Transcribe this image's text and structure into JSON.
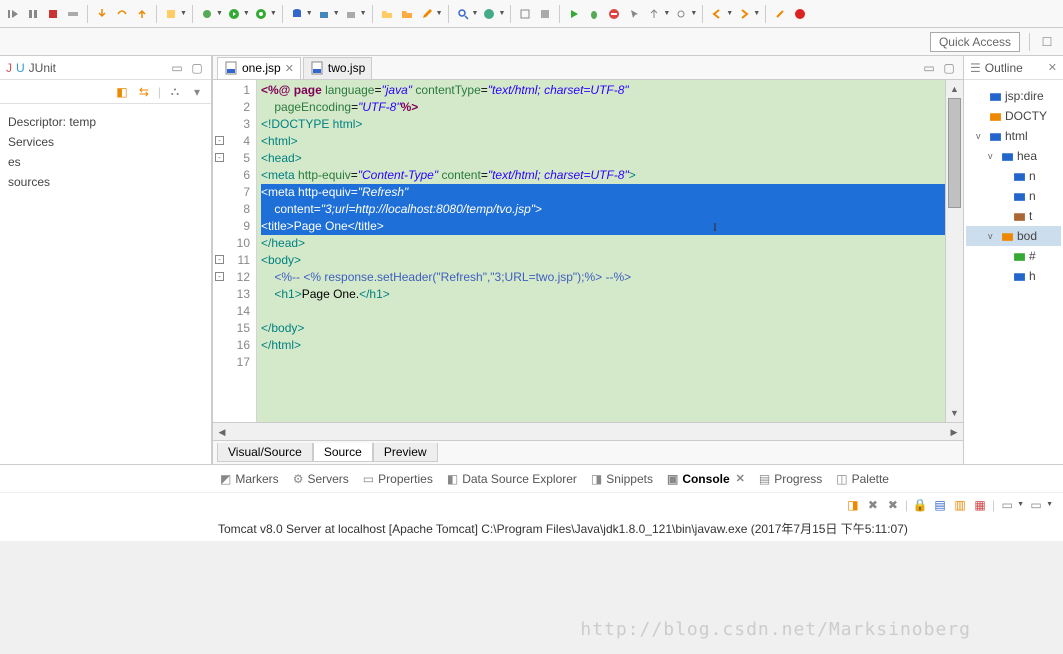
{
  "quick_access": "Quick Access",
  "left_panel": {
    "title": "JUnit",
    "tree": [
      "Descriptor: temp",
      " Services",
      "es",
      "sources"
    ]
  },
  "tabs": {
    "active": "one.jsp",
    "inactive": "two.jsp"
  },
  "code": {
    "lines": [
      {
        "n": 1,
        "html": "<span class='maroon'>&lt;%@</span> <span class='maroon'>page</span> <span class='green-t'>language</span>=<span class='blue-s'>\"java\"</span> <span class='green-t'>contentType</span>=<span class='blue-s'>\"text/html; charset=UTF-8\"</span>"
      },
      {
        "n": 2,
        "html": "    <span class='green-t'>pageEncoding</span>=<span class='blue-s'>\"UTF-8\"</span><span class='maroon'>%&gt;</span>"
      },
      {
        "n": 3,
        "html": "<span class='teal'>&lt;!DOCTYPE html&gt;</span>"
      },
      {
        "n": 4,
        "fold": "-",
        "html": "<span class='teal'>&lt;html&gt;</span>"
      },
      {
        "n": 5,
        "fold": "-",
        "html": "<span class='teal'>&lt;head&gt;</span>"
      },
      {
        "n": 6,
        "html": "<span class='teal'>&lt;meta</span> <span class='green-t'>http-equiv</span>=<span class='blue-s'>\"Content-Type\"</span> <span class='green-t'>content</span>=<span class='blue-s'>\"text/html; charset=UTF-8\"</span><span class='teal'>&gt;</span>"
      },
      {
        "n": 7,
        "sel": true,
        "html": "&lt;meta http-equiv=<span class='green-i'>\"Refresh\"</span>"
      },
      {
        "n": 8,
        "sel": true,
        "html": "    content=<span class='green-i'>\"3;url=http://localhost:8080/temp/tvo.jsp\"</span>&gt;"
      },
      {
        "n": 9,
        "sel": true,
        "html": "&lt;title&gt;Page One&lt;/title&gt;"
      },
      {
        "n": 10,
        "html": "<span class='teal'>&lt;/head&gt;</span>"
      },
      {
        "n": 11,
        "fold": "-",
        "html": "<span class='teal'>&lt;body&gt;</span>"
      },
      {
        "n": 12,
        "fold": "-",
        "html": "    <span class='cm'>&lt;%-- &lt;% response.setHeader(\"Refresh\",\"3;URL=two.jsp\");%&gt; --%&gt;</span>"
      },
      {
        "n": 13,
        "html": "    <span class='teal'>&lt;h1&gt;</span><span class='black'>Page One.</span><span class='teal'>&lt;/h1&gt;</span>"
      },
      {
        "n": 14,
        "html": ""
      },
      {
        "n": 15,
        "html": "<span class='teal'>&lt;/body&gt;</span>"
      },
      {
        "n": 16,
        "html": "<span class='teal'>&lt;/html&gt;</span>"
      },
      {
        "n": 17,
        "html": ""
      }
    ]
  },
  "bottom_tabs": [
    "Visual/Source",
    "Source",
    "Preview"
  ],
  "views": [
    "Markers",
    "Servers",
    "Properties",
    "Data Source Explorer",
    "Snippets",
    "Console",
    "Progress",
    "Palette"
  ],
  "active_view": "Console",
  "console_line": "Tomcat v8.0 Server at localhost [Apache Tomcat] C:\\Program Files\\Java\\jdk1.8.0_121\\bin\\javaw.exe (2017年7月15日 下午5:11:07)",
  "outline": {
    "title": "Outline",
    "items": [
      {
        "indent": 1,
        "icon": "blue",
        "label": "jsp:dire"
      },
      {
        "indent": 1,
        "icon": "orange",
        "label": "DOCTY"
      },
      {
        "indent": 1,
        "twist": "v",
        "icon": "blue",
        "label": "html"
      },
      {
        "indent": 2,
        "twist": "v",
        "icon": "blue",
        "label": "hea"
      },
      {
        "indent": 3,
        "icon": "blue",
        "label": "n"
      },
      {
        "indent": 3,
        "icon": "blue",
        "label": "n"
      },
      {
        "indent": 3,
        "icon": "brown",
        "label": "t"
      },
      {
        "indent": 2,
        "twist": "v",
        "icon": "orange",
        "label": "bod",
        "sel": true
      },
      {
        "indent": 3,
        "icon": "green",
        "label": "#"
      },
      {
        "indent": 3,
        "icon": "blue",
        "label": "h"
      }
    ]
  },
  "watermark": "http://blog.csdn.net/Marksinoberg"
}
